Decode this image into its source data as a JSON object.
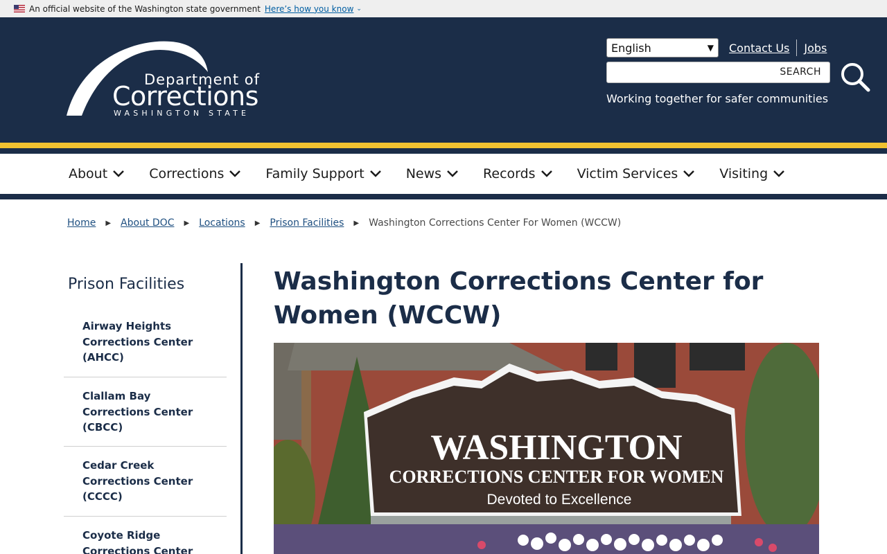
{
  "gov_banner": {
    "text": "An official website of the Washington state government",
    "link": "Here’s how you know"
  },
  "logo": {
    "line1": "Department of",
    "line2": "Corrections",
    "line3": "WASHINGTON STATE"
  },
  "header": {
    "language": "English",
    "links": [
      "Contact Us",
      "Jobs"
    ],
    "search_button": "SEARCH",
    "tagline": "Working together for safer communities"
  },
  "nav": [
    "About",
    "Corrections",
    "Family Support",
    "News",
    "Records",
    "Victim Services",
    "Visiting"
  ],
  "breadcrumb": {
    "links": [
      "Home",
      "About DOC",
      "Locations",
      "Prison Facilities"
    ],
    "current": "Washington Corrections Center For Women (WCCW)"
  },
  "sidebar": {
    "title": "Prison Facilities",
    "items": [
      [
        "Airway Heights",
        "Corrections Center",
        "(AHCC)"
      ],
      [
        "Clallam Bay",
        "Corrections Center",
        "(CBCC)"
      ],
      [
        "Cedar Creek",
        "Corrections Center",
        "(CCCC)"
      ],
      [
        "Coyote Ridge",
        "Corrections Center"
      ]
    ]
  },
  "main": {
    "title_line1": "Washington Corrections Center for",
    "title_line2": "Women (WCCW)"
  },
  "sign": {
    "line1": "WASHINGTON",
    "line2": "CORRECTIONS CENTER FOR WOMEN",
    "line3": "Devoted to Excellence"
  },
  "colors": {
    "navy": "#1b2d48",
    "gold": "#f2c230",
    "link": "#1e4f80"
  }
}
